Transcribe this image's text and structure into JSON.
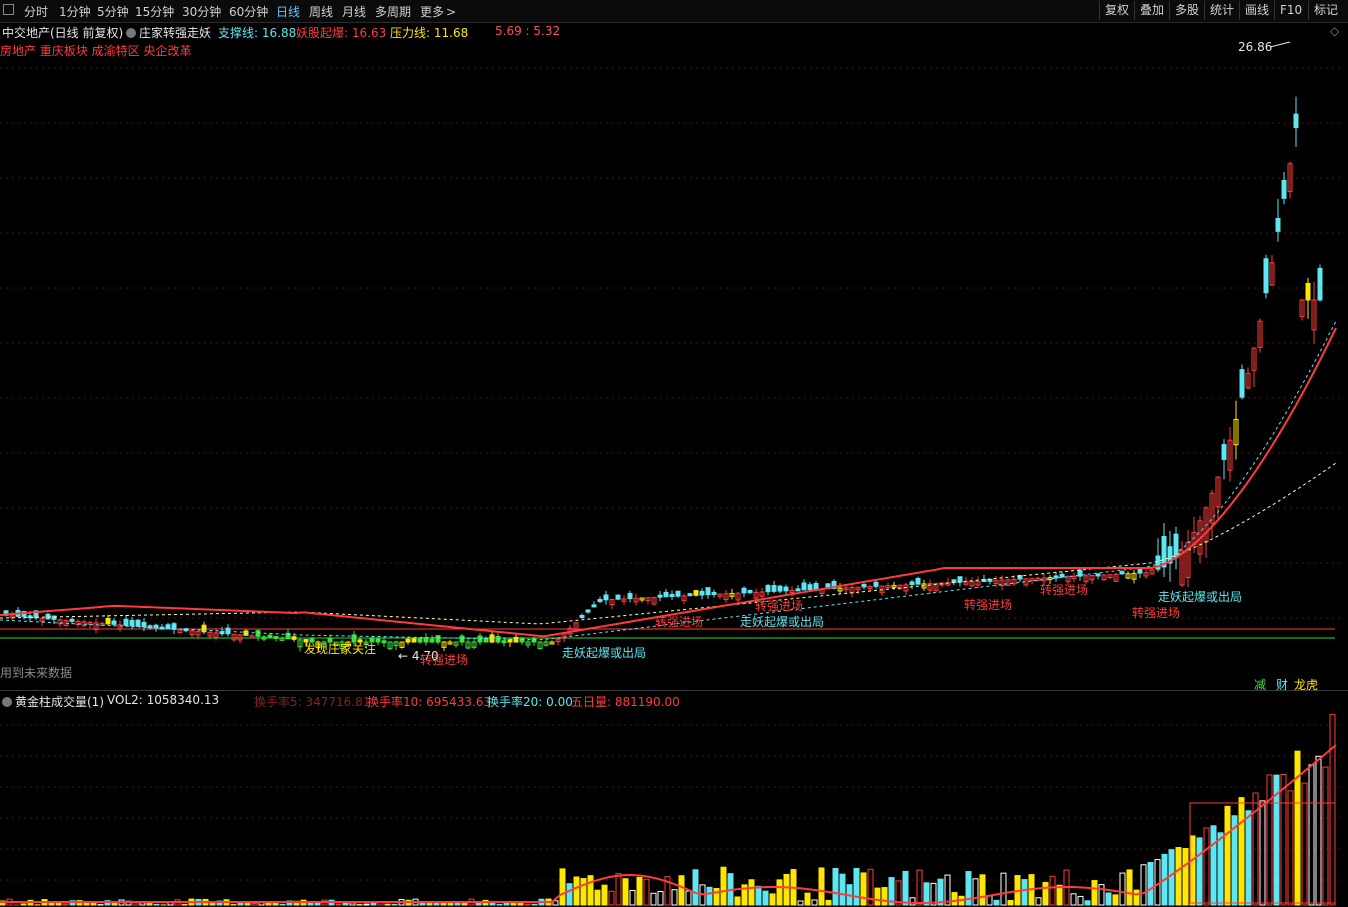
{
  "toolbar": {
    "periods": [
      "分时",
      "1分钟",
      "5分钟",
      "15分钟",
      "30分钟",
      "60分钟",
      "日线",
      "周线",
      "月线",
      "多周期",
      "更多"
    ],
    "active_period": "日线",
    "more_chevron": "chevron-right-icon",
    "right_buttons": [
      "复权",
      "叠加",
      "多股",
      "统计",
      "画线",
      "F10",
      "标记"
    ]
  },
  "main": {
    "stock_title": "中交地产(日线 前复权)",
    "indicator_name": "庄家转强走妖",
    "support_label": "支撑线: 16.88",
    "explode_label": "妖股起爆: 16.63",
    "pressure_label": "压力线: 11.68",
    "extra_values": "5.69 : 5.32",
    "concepts": "房地产 重庆板块 成渝特区 央企改革",
    "high_marker": "26.86",
    "low_marker": "4.70",
    "future_data": "用到未来数据",
    "badges": [
      "减",
      "财",
      "龙虎"
    ],
    "annotations": [
      {
        "text": "发现庄家关注",
        "color": "#ffe600"
      },
      {
        "text": "转强进场",
        "color": "#ff3b3b"
      },
      {
        "text": "走妖起爆或出局",
        "color": "#5ee6f2"
      },
      {
        "text": "转强进场",
        "color": "#ff3b3b"
      },
      {
        "text": "转强进场",
        "color": "#ff3b3b"
      },
      {
        "text": "走妖起爆或出局",
        "color": "#5ee6f2"
      },
      {
        "text": "转强进场",
        "color": "#ff3b3b"
      },
      {
        "text": "转强进场",
        "color": "#ff3b3b"
      },
      {
        "text": "转强进场",
        "color": "#ff3b3b"
      },
      {
        "text": "走妖起爆或出局",
        "color": "#5ee6f2"
      }
    ]
  },
  "volume": {
    "title": "黄金柱成交量(1)",
    "vol2": "VOL2: 1058340.13",
    "turnover5": "换手率5: 347716.81",
    "turnover10": "换手率10: 695433.63",
    "turnover20": "换手率20: 0.00",
    "five_day": "五日量: 881190.00"
  },
  "colors": {
    "up": "#ff3b3b",
    "down": "#5ee6f2",
    "yellow": "#ffe600",
    "green": "#3ee03e",
    "ma_white": "#ffffff",
    "ma_cyan": "#5ee6f2",
    "ma_yellow": "#ffe600",
    "blue": "#1a3cff"
  }
}
